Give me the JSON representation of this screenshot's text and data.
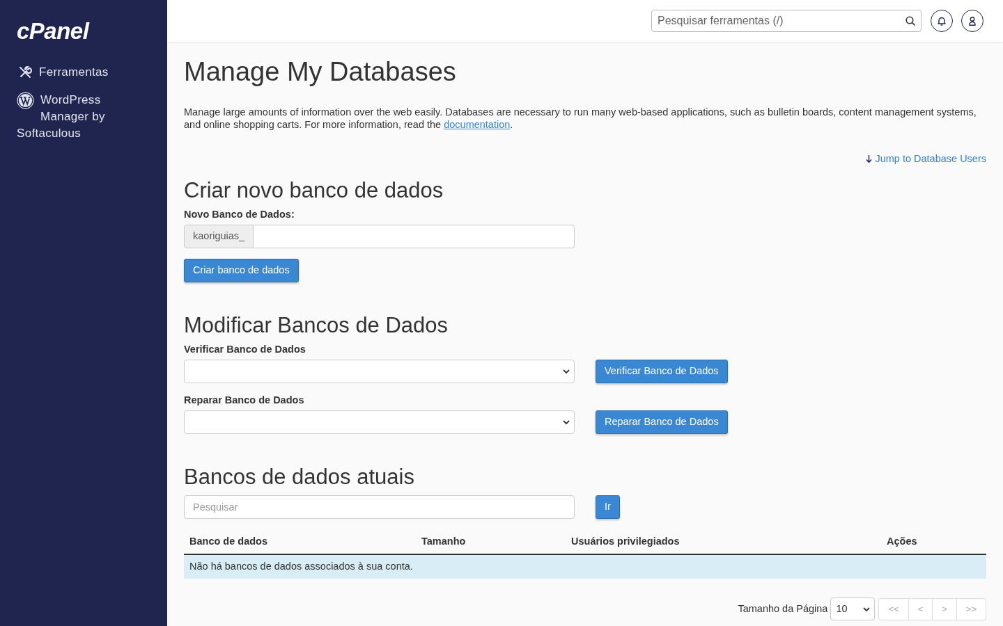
{
  "sidebar": {
    "logo": "cPanel",
    "items": [
      {
        "label": "Ferramentas"
      },
      {
        "label": "WordPress Manager by Softaculous"
      }
    ]
  },
  "topbar": {
    "search": {
      "placeholder": "Pesquisar ferramentas (/)"
    }
  },
  "page": {
    "title": "Manage My Databases",
    "description": {
      "text_before": "Manage large amounts of information over the web easily. Databases are necessary to run many web-based applications, such as bulletin boards, content management systems, and online shopping carts. For more information, read the ",
      "link": "documentation",
      "text_after": "."
    },
    "jump_link": "Jump to Database Users"
  },
  "create_database": {
    "heading": "Criar novo banco de dados",
    "label": "Novo Banco de Dados:",
    "prefix": "kaoriguias_",
    "button": "Criar banco de dados"
  },
  "modify_databases": {
    "heading": "Modificar Bancos de Dados",
    "actions": [
      {
        "label": "Verificar Banco de Dados",
        "button": "Verificar Banco de Dados"
      },
      {
        "label": "Reparar Banco de Dados",
        "button": "Reparar Banco de Dados"
      }
    ]
  },
  "current_databases": {
    "heading": "Bancos de dados atuais",
    "search": {
      "placeholder": "Pesquisar"
    },
    "search_button": "Ir",
    "table": {
      "columns": [
        "Banco de dados",
        "Tamanho",
        "Usuários privilegiados",
        "Ações"
      ],
      "empty_message": "Não há bancos de dados associados à sua conta."
    },
    "pagination": {
      "page_size_label": "Tamanho da Página",
      "page_size": "10",
      "buttons": [
        {
          "label": "<<",
          "disabled": true
        },
        {
          "label": "<",
          "disabled": true
        },
        {
          "label": ">",
          "disabled": true
        },
        {
          "label": ">>",
          "disabled": true
        }
      ]
    }
  }
}
